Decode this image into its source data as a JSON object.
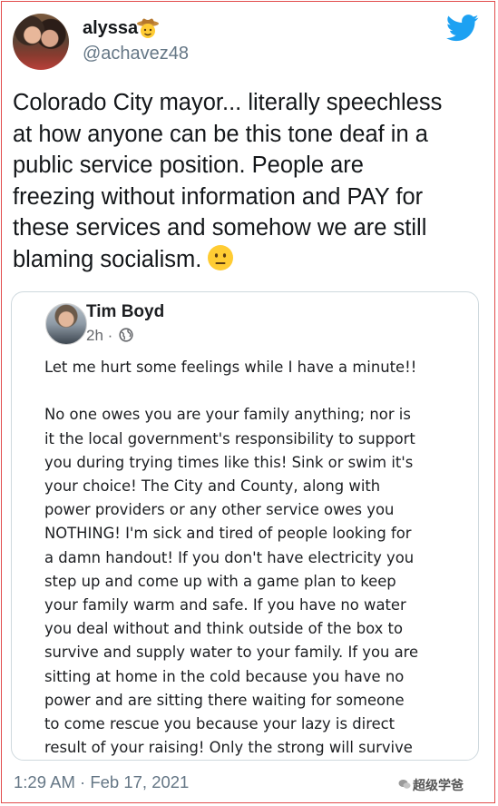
{
  "tweet": {
    "display_name": "alyssa",
    "handle": "@achavez48",
    "text_lines": [
      "Colorado City mayor... literally speechless",
      "at how anyone can be this tone deaf in a",
      "public service position. People are",
      "freezing without information and PAY for",
      "these services and somehow we are still",
      "blaming socialism."
    ],
    "date": "1:29 AM · Feb 17, 2021"
  },
  "quoted_post": {
    "author": "Tim Boyd",
    "time": "2h ·",
    "first_line": "Let me hurt some feelings while I have a minute!!",
    "body_lines": [
      "No one owes you are your family anything; nor is",
      "it the local government's responsibility to support",
      "you during trying times like this! Sink or swim it's",
      "your choice!  The City and County, along with",
      "power providers or any other service owes you",
      "NOTHING!  I'm sick and tired of people looking for",
      "a damn handout!  If you don't have electricity you",
      "step up and come up with a game plan to keep",
      "your family warm and safe. If you have no water",
      "you deal without and think outside of the box to",
      "survive and supply water to your family. If you are",
      "sitting at home in the cold because you have no",
      "power and are sitting there waiting for someone",
      "to come rescue you because your lazy is direct",
      "result of your raising!  Only the strong will survive"
    ]
  },
  "watermark": "超级学爸",
  "icons": {
    "brand": "twitter-bird-icon",
    "emoji_name": "cowboy-emoji",
    "emoji_text": "neutral-face-emoji",
    "privacy": "globe-icon"
  },
  "colors": {
    "twitter_blue": "#1da1f2",
    "border_red": "#e24a4a",
    "text": "#14171a",
    "secondary": "#657786"
  }
}
